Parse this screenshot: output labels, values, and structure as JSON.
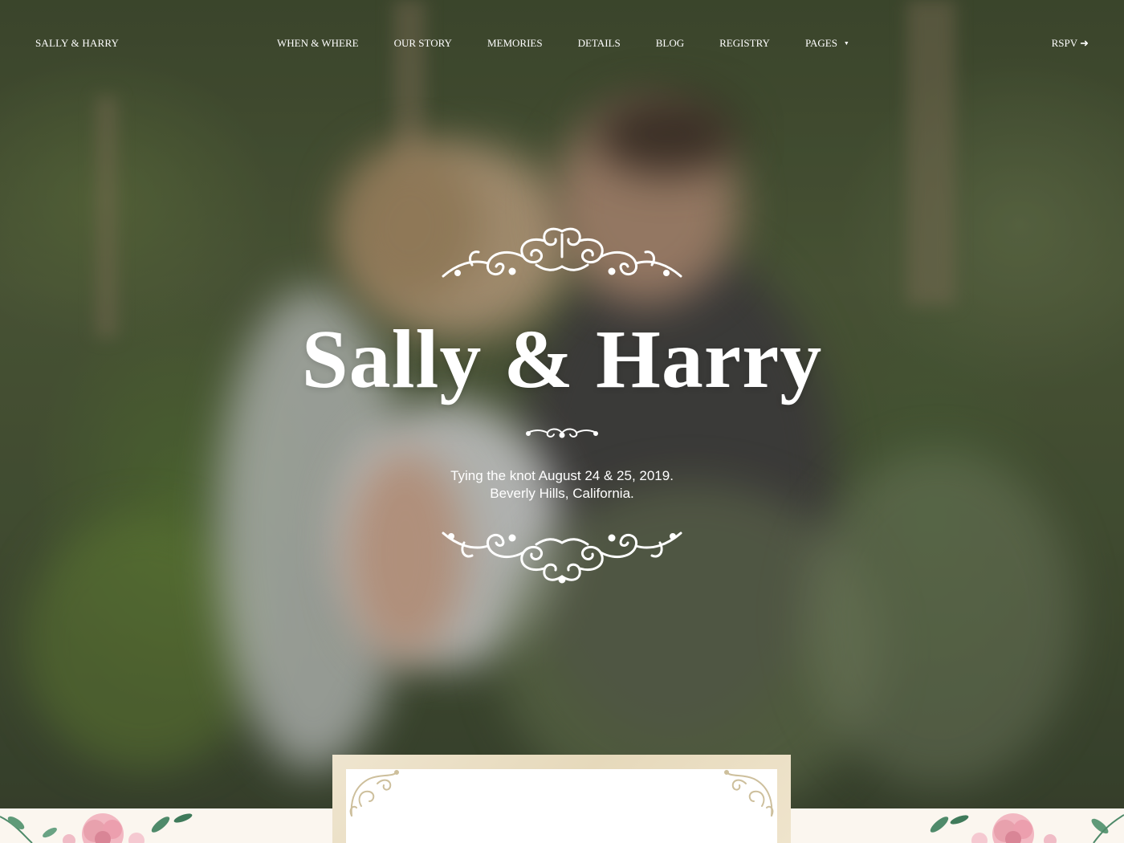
{
  "nav": {
    "brand": "SALLY & HARRY",
    "items": [
      {
        "label": "WHEN & WHERE"
      },
      {
        "label": "OUR STORY"
      },
      {
        "label": "MEMORIES"
      },
      {
        "label": "DETAILS"
      },
      {
        "label": "BLOG"
      },
      {
        "label": "REGISTRY"
      },
      {
        "label": "PAGES"
      }
    ],
    "rsvp": "RSPV ➜"
  },
  "hero": {
    "title": "Sally & Harry",
    "line1": "Tying the knot August 24 & 25, 2019.",
    "line2": "Beverly Hills, California."
  },
  "icons": {
    "top_ornament": "flourish-ornament-icon",
    "divider": "small-flourish-icon",
    "bottom_ornament": "flourish-ornament-icon",
    "pages_caret": "caret-down-icon",
    "rsvp_arrow": "arrow-right-icon"
  },
  "colors": {
    "text": "#ffffff",
    "strip": "#fbf6ef",
    "card_frame": "#e9dec4",
    "rose": "#e8a1ad",
    "leaf": "#4f8a6a"
  }
}
